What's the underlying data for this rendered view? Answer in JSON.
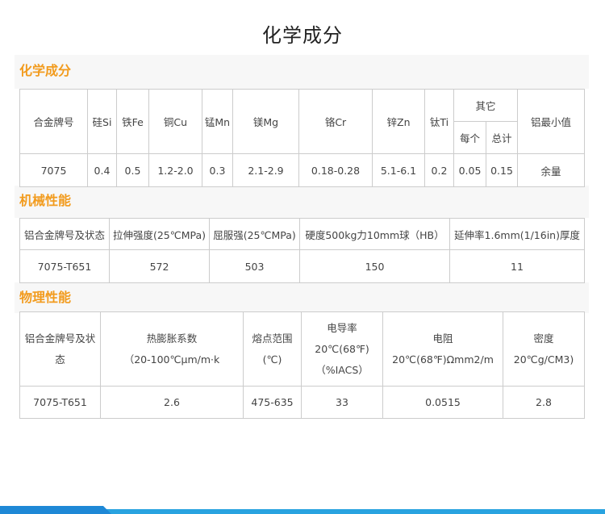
{
  "page_title": "化学成分",
  "chem": {
    "heading": "化学成分",
    "h_alloy": "合金牌号",
    "h_si": "硅Si",
    "h_fe": "铁Fe",
    "h_cu": "铜Cu",
    "h_mn": "锰Mn",
    "h_mg": "镁Mg",
    "h_cr": "铬Cr",
    "h_zn": "锌Zn",
    "h_ti": "钛Ti",
    "h_other": "其它",
    "h_each": "每个",
    "h_total": "总计",
    "h_al": "铝最小值",
    "row": {
      "alloy": "7075",
      "si": "0.4",
      "fe": "0.5",
      "cu": "1.2-2.0",
      "mn": "0.3",
      "mg": "2.1-2.9",
      "cr": "0.18-0.28",
      "zn": "5.1-6.1",
      "ti": "0.2",
      "each": "0.05",
      "total": "0.15",
      "al": "余量"
    }
  },
  "mech": {
    "heading": "机械性能",
    "h_alloy": "铝合金牌号及状态",
    "h_tensile": "拉伸强度(25℃MPa)",
    "h_yield": "屈服强(25℃MPa)",
    "h_hardness": "硬度500kg力10mm球（HB）",
    "h_elong": "延伸率1.6mm(1/16in)厚度",
    "row": {
      "alloy": "7075-T651",
      "tensile": "572",
      "yield": "503",
      "hardness": "150",
      "elong": "11"
    }
  },
  "phys": {
    "heading": "物理性能",
    "h_alloy": "铝合金牌号及状态",
    "h_exp_1": "热膨胀系数",
    "h_exp_2": "（20-100℃μm/m·k",
    "h_melt_1": "熔点范围",
    "h_melt_2": "(℃)",
    "h_cond_1": "电导率",
    "h_cond_2": "20℃(68℉)",
    "h_cond_3": "（%IACS）",
    "h_res_1": "电阻",
    "h_res_2": "20℃(68℉)Ωmm2/m",
    "h_dens_1": "密度",
    "h_dens_2": "20℃g/CM3)",
    "row": {
      "alloy": "7075-T651",
      "exp": "2.6",
      "melt": "475-635",
      "cond": "33",
      "res": "0.0515",
      "dens": "2.8"
    }
  }
}
